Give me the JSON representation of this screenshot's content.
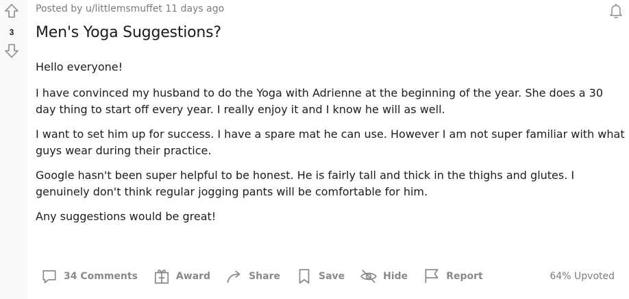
{
  "post": {
    "meta": "Posted by u/littlemsmuffet 11 days ago",
    "score": "3",
    "title": "Men's Yoga Suggestions?",
    "paragraphs": [
      "Hello everyone!",
      "I have convinced my husband to do the Yoga with Adrienne at the beginning of the year. She does a 30 day thing to start off every year. I really enjoy it and I know he will as well.",
      "I want to set him up for success. I have a spare mat he can use. However I am not super familiar with what guys wear during their practice.",
      "Google hasn't been super helpful to be honest. He is fairly tall and thick in the thighs and glutes. I genuinely don't think regular jogging pants will be comfortable for him.",
      "Any suggestions would be great!"
    ]
  },
  "actions": {
    "comments_label": "34 Comments",
    "award_label": "Award",
    "share_label": "Share",
    "save_label": "Save",
    "hide_label": "Hide",
    "report_label": "Report"
  },
  "upvoted": "64% Upvoted",
  "icons": {
    "upvote": "arrow-up-icon",
    "downvote": "arrow-down-icon",
    "notifications": "bell-icon",
    "comments": "comment-icon",
    "award": "gift-icon",
    "share": "share-arrow-icon",
    "save": "bookmark-icon",
    "hide": "eye-off-icon",
    "report": "flag-icon"
  },
  "colors": {
    "icon_gray": "#878a8c",
    "meta_gray": "#787c7e",
    "text": "#1c1c1c",
    "vote_column_bg": "#f8f9fa"
  }
}
